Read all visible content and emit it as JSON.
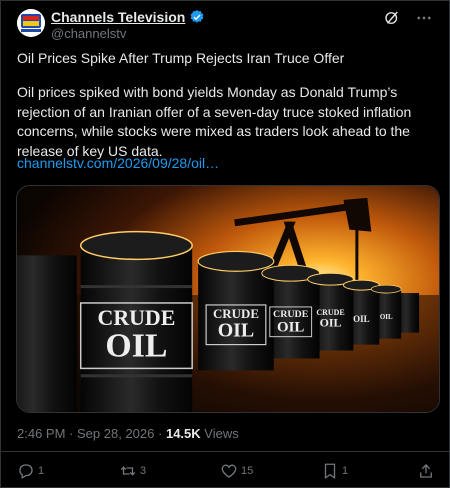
{
  "account": {
    "display_name": "Channels Television",
    "handle": "@channelstv",
    "avatar_icon": "channels-logo-icon",
    "verified": true
  },
  "post": {
    "title": "Oil Prices Spike After Trump Rejects Iran Truce Offer",
    "body": "Oil prices spiked with bond yields Monday as Donald Trump’s rejection of an Iranian offer of a seven-day truce stoked inflation concerns, while stocks were mixed as traders look ahead to the release of key US data.",
    "link_text": "channelstv.com/2026/09/28/oil…",
    "media": {
      "labels": [
        "CRUDE",
        "OIL"
      ]
    }
  },
  "meta": {
    "time": "2:46 PM",
    "separator": "·",
    "date": "Sep 28, 2026",
    "views_count": "14.5K",
    "views_label": "Views"
  },
  "actions": {
    "replies": "1",
    "reposts": "3",
    "likes": "15",
    "bookmarks": "1"
  },
  "colors": {
    "background": "#000000",
    "text": "#e7e9ea",
    "muted": "#71767b",
    "link": "#1d9bf0",
    "border": "#2f3336"
  }
}
